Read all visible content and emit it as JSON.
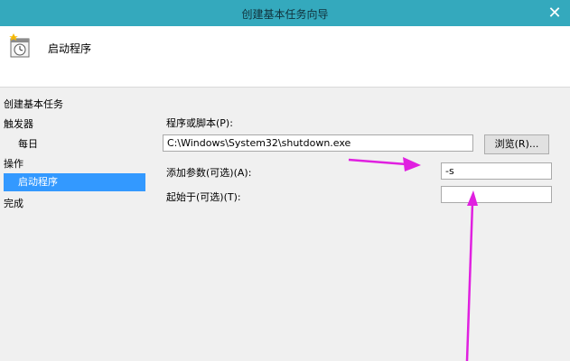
{
  "window": {
    "title": "创建基本任务向导",
    "close_glyph": "✕"
  },
  "header": {
    "title": "启动程序",
    "icon": "scheduled-task-clock-icon"
  },
  "nav": {
    "items": [
      {
        "label": "创建基本任务",
        "selected": false
      },
      {
        "label": "触发器",
        "selected": false
      },
      {
        "label": "每日",
        "selected": false
      },
      {
        "label": "操作",
        "selected": false
      },
      {
        "label": "启动程序",
        "selected": true
      },
      {
        "label": "完成",
        "selected": false
      }
    ]
  },
  "form": {
    "program_label": "程序或脚本(P):",
    "program_value": "C:\\Windows\\System32\\shutdown.exe",
    "browse_label": "浏览(R)...",
    "args_label": "添加参数(可选)(A):",
    "args_value": "-s",
    "startin_label": "起始于(可选)(T):",
    "startin_value": ""
  },
  "annotation": {
    "arrow_color": "#e020e0"
  }
}
